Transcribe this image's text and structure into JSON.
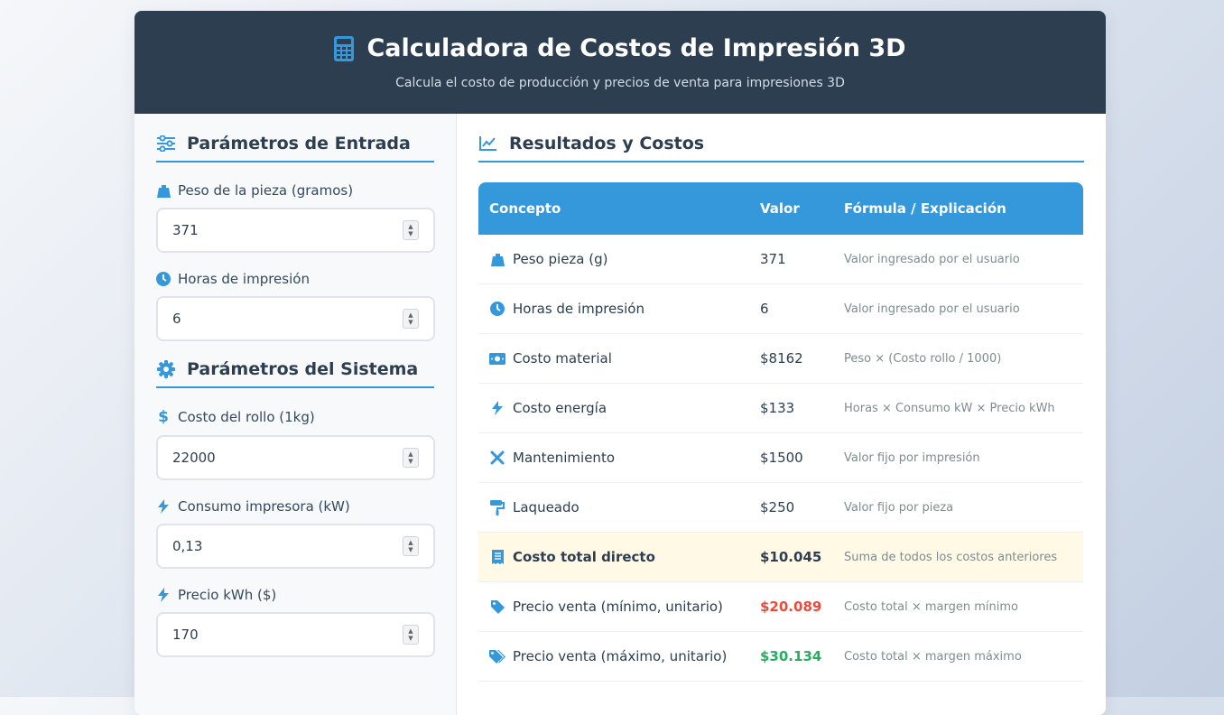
{
  "header": {
    "title": "Calculadora de Costos de Impresión 3D",
    "subtitle": "Calcula el costo de producción y precios de venta para impresiones 3D"
  },
  "input_section": {
    "title": "Parámetros de Entrada",
    "fields": [
      {
        "label": "Peso de la pieza (gramos)",
        "value": "371",
        "icon": "weight-icon"
      },
      {
        "label": "Horas de impresión",
        "value": "6",
        "icon": "clock-icon"
      }
    ]
  },
  "system_section": {
    "title": "Parámetros del Sistema",
    "fields": [
      {
        "label": "Costo del rollo (1kg)",
        "value": "22000",
        "icon": "dollar-icon"
      },
      {
        "label": "Consumo impresora (kW)",
        "value": "0,13",
        "icon": "bolt-icon"
      },
      {
        "label": "Precio kWh ($)",
        "value": "170",
        "icon": "bolt-icon"
      }
    ]
  },
  "results": {
    "title": "Resultados y Costos",
    "columns": [
      "Concepto",
      "Valor",
      "Fórmula / Explicación"
    ],
    "rows": [
      {
        "concept": "Peso pieza (g)",
        "value": "371",
        "explanation": "Valor ingresado por el usuario",
        "icon": "weight-icon"
      },
      {
        "concept": "Horas de impresión",
        "value": "6",
        "explanation": "Valor ingresado por el usuario",
        "icon": "clock-icon"
      },
      {
        "concept": "Costo material",
        "value": "$8162",
        "explanation": "Peso × (Costo rollo / 1000)",
        "icon": "money-icon"
      },
      {
        "concept": "Costo energía",
        "value": "$133",
        "explanation": "Horas × Consumo kW × Precio kWh",
        "icon": "bolt-icon"
      },
      {
        "concept": "Mantenimiento",
        "value": "$1500",
        "explanation": "Valor fijo por impresión",
        "icon": "tools-icon"
      },
      {
        "concept": "Laqueado",
        "value": "$250",
        "explanation": "Valor fijo por pieza",
        "icon": "paint-roller-icon"
      },
      {
        "concept": "Costo total directo",
        "value": "$10.045",
        "explanation": "Suma de todos los costos anteriores",
        "icon": "receipt-icon"
      },
      {
        "concept": "Precio venta (mínimo, unitario)",
        "value": "$20.089",
        "explanation": "Costo total × margen mínimo",
        "icon": "tag-icon"
      },
      {
        "concept": "Precio venta (máximo, unitario)",
        "value": "$30.134",
        "explanation": "Costo total × margen máximo",
        "icon": "tags-icon"
      }
    ]
  },
  "colors": {
    "header_bg": "#2c3e50",
    "accent": "#3498db",
    "price_min": "#e74c3c",
    "price_max": "#27ae60",
    "total_row_bg": "#fff9e6"
  }
}
